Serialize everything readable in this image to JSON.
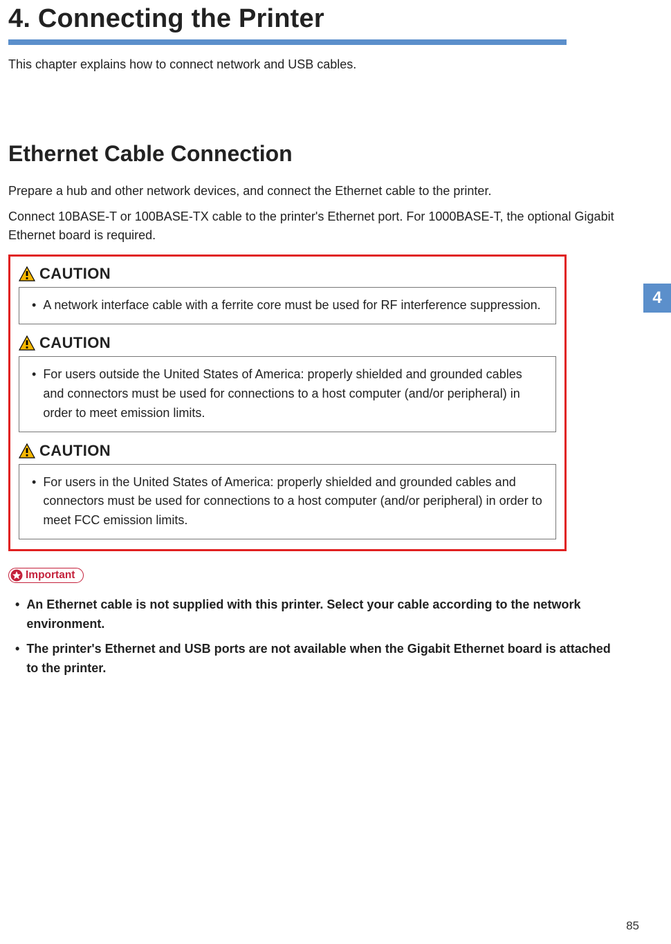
{
  "chapter": {
    "title": "4. Connecting the Printer",
    "intro": "This chapter explains how to connect network and USB cables."
  },
  "section": {
    "title": "Ethernet Cable Connection",
    "p1": "Prepare a hub and other network devices, and connect the Ethernet cable to the printer.",
    "p2": "Connect 10BASE-T or 100BASE-TX cable to the printer's Ethernet port. For 1000BASE-T, the optional Gigabit Ethernet board is required."
  },
  "caution_label": "CAUTION",
  "cautions": [
    "A network interface cable with a ferrite core must be used for RF interference suppression.",
    "For users outside the United States of America: properly shielded and grounded cables and connectors must be used for connections to a host computer (and/or peripheral) in order to meet emission limits.",
    "For users in the United States of America: properly shielded and grounded cables and connectors must be used for connections to a host computer (and/or peripheral) in order to meet FCC emission limits."
  ],
  "important_label": "Important",
  "important_items": [
    "An Ethernet cable is not supplied with this printer. Select your cable according to the network environment.",
    "The printer's Ethernet and USB ports are not available when the Gigabit Ethernet board is attached to the printer."
  ],
  "side_tab": "4",
  "page_number": "85",
  "bullet": "•"
}
